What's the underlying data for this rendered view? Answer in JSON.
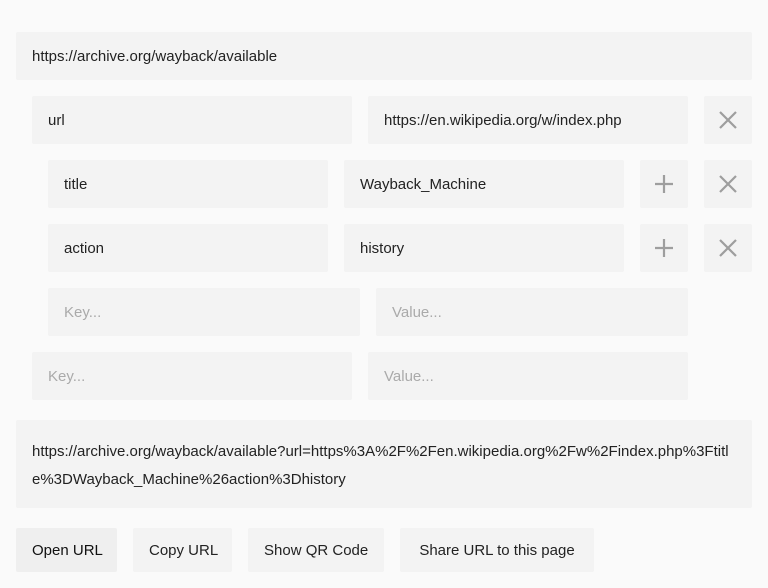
{
  "base_url": "https://archive.org/wayback/available",
  "params": {
    "url": {
      "key": "url",
      "value": "https://en.wikipedia.org/w/index.php",
      "sub": [
        {
          "key": "title",
          "value": "Wayback_Machine"
        },
        {
          "key": "action",
          "value": "history"
        }
      ],
      "sub_new": {
        "key_placeholder": "Key...",
        "value_placeholder": "Value..."
      }
    },
    "new": {
      "key_placeholder": "Key...",
      "value_placeholder": "Value..."
    }
  },
  "output": {
    "url": "https://archive.org/wayback/available?url=https%3A%2F%2Fen.wikipedia.org%2Fw%2Findex.php%3Ftitle%3DWayback_Machine%26action%3Dhistory"
  },
  "buttons": {
    "open": "Open URL",
    "copy": "Copy URL",
    "qr": "Show QR Code",
    "share": "Share URL to this page"
  },
  "icons": {
    "remove": "close-icon",
    "add": "plus-icon"
  },
  "colors": {
    "background": "#fafafa",
    "field": "#f3f3f3",
    "icon": "#9e9e9e",
    "placeholder": "#aaaaaa"
  }
}
